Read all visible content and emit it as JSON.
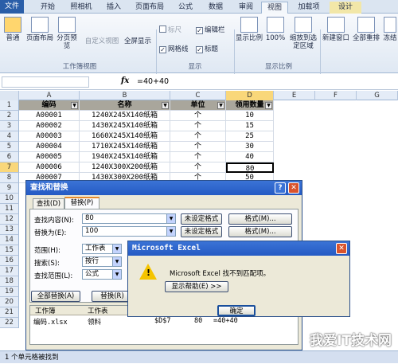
{
  "ribbon": {
    "tabs": [
      "文件",
      "开始",
      "照相机",
      "插入",
      "页面布局",
      "公式",
      "数据",
      "审阅",
      "视图",
      "加载项",
      "设计"
    ],
    "active_tab": "视图",
    "buttons": {
      "normal": "普通",
      "page_layout": "页面布局",
      "page_break": "分页预览",
      "custom_view": "自定义视图",
      "full_screen": "全屏显示",
      "zoom": "显示比例",
      "zoom_100": "100%",
      "zoom_selection": "缩放到选定区域",
      "new_window": "新建窗口",
      "arrange_all": "全部重排",
      "freeze": "冻结"
    },
    "checks": {
      "ruler": "标尺",
      "formula_bar": "编辑栏",
      "gridlines": "网格线",
      "headings": "标题"
    },
    "groups": {
      "workbook_views": "工作簿视图",
      "show": "显示",
      "zoom_group": "显示比例"
    }
  },
  "formula_bar": {
    "fx": "fx",
    "content": "=40+40"
  },
  "sheet": {
    "columns": [
      "A",
      "B",
      "C",
      "D",
      "E",
      "F",
      "G"
    ],
    "rows": [
      "1",
      "2",
      "3",
      "4",
      "5",
      "6",
      "7",
      "8",
      "9",
      "10",
      "11",
      "12",
      "13",
      "14",
      "15",
      "16",
      "17",
      "18",
      "19",
      "20",
      "21",
      "22"
    ],
    "headers": [
      "编码",
      "名称",
      "单位",
      "领用数量"
    ],
    "data": [
      [
        "A00001",
        "1240X245X140纸箱",
        "个",
        "10"
      ],
      [
        "A00002",
        "1430X245X140纸箱",
        "个",
        "15"
      ],
      [
        "A00003",
        "1660X245X140纸箱",
        "个",
        "25"
      ],
      [
        "A00004",
        "1710X245X140纸箱",
        "个",
        "30"
      ],
      [
        "A00005",
        "1940X245X140纸箱",
        "个",
        "40"
      ],
      [
        "A00006",
        "1240X300X200纸箱",
        "个",
        "80"
      ],
      [
        "A00007",
        "1430X300X200纸箱",
        "个",
        "50"
      ]
    ]
  },
  "find_replace": {
    "title": "查找和替换",
    "tab_find": "查找(D)",
    "tab_replace": "替换(P)",
    "find_label": "查找内容(N):",
    "find_value": "80",
    "replace_label": "替换为(E):",
    "replace_value": "100",
    "no_format_1": "未设定格式",
    "no_format_2": "未设定格式",
    "format_btn_1": "格式(M)...",
    "format_btn_2": "格式(M)...",
    "within_label": "范围(H):",
    "within_value": "工作表",
    "search_label": "搜索(S):",
    "search_value": "按行",
    "lookin_label": "查找范围(L):",
    "lookin_value": "公式",
    "replace_all": "全部替换(A)",
    "replace": "替换(R)",
    "results_headers": [
      "工作簿",
      "工作表"
    ],
    "result_row": [
      "编码.xlsx",
      "领料",
      "$D$7",
      "80",
      "=40+40"
    ],
    "status": "1 个单元格被找到"
  },
  "msgbox": {
    "title": "Microsoft Excel",
    "message": "Microsoft Excel 找不到匹配项。",
    "help_button": "显示帮助(E) >>",
    "ok_button": "确定"
  },
  "watermark": "我爱IT技术网"
}
